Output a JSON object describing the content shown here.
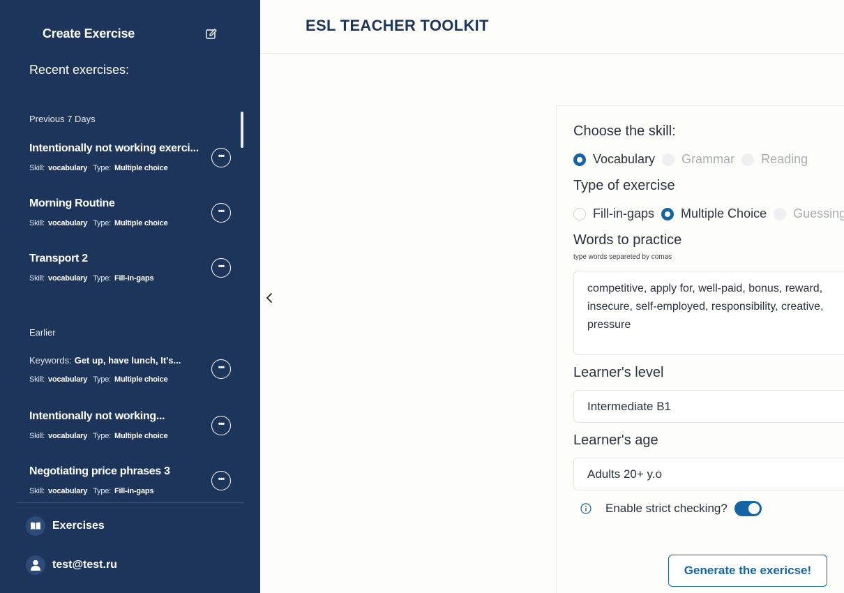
{
  "app": {
    "title": "ESL TEACHER TOOLKIT"
  },
  "sidebar": {
    "create_label": "Create Exercise",
    "recent_label": "Recent exercises:",
    "groups": [
      {
        "label": "Previous 7 Days"
      },
      {
        "label": "Earlier"
      }
    ],
    "meta_labels": {
      "skill": "Skill:",
      "type": "Type:",
      "keywords": "Keywords:"
    },
    "items": [
      {
        "title": "Intentionally not working exerci...",
        "skill": "vocabulary",
        "type": "Multiple choice"
      },
      {
        "title": "Morning Routine",
        "skill": "vocabulary",
        "type": "Multiple choice"
      },
      {
        "title": "Transport 2",
        "skill": "vocabulary",
        "type": "Fill-in-gaps"
      },
      {
        "keywords": "Get up, have lunch, It's...",
        "skill": "vocabulary",
        "type": "Multiple choice"
      },
      {
        "title": "Intentionally not working...",
        "skill": "vocabulary",
        "type": "Multiple choice"
      },
      {
        "title": "Negotiating price phrases 3",
        "skill": "vocabulary",
        "type": "Fill-in-gaps"
      }
    ],
    "nav": {
      "exercises_label": "Exercises",
      "user_email": "test@test.ru"
    }
  },
  "form": {
    "skill_label": "Choose the skill:",
    "skills": [
      {
        "label": "Vocabulary",
        "state": "selected"
      },
      {
        "label": "Grammar",
        "state": "disabled"
      },
      {
        "label": "Reading",
        "state": "disabled"
      }
    ],
    "type_label": "Type of exercise",
    "types": [
      {
        "label": "Fill-in-gaps",
        "state": "unselected"
      },
      {
        "label": "Multiple Choice",
        "state": "selected"
      },
      {
        "label": "Guessing",
        "state": "disabled"
      }
    ],
    "words_label": "Words to practice",
    "words_hint": "type words separeted by comas",
    "words_value": "competitive, apply for, well-paid, bonus, reward, insecure, self-employed, responsibility, creative, pressure",
    "level_label": "Learner's level",
    "level_value": "Intermediate B1",
    "age_label": "Learner's age",
    "age_value": "Adults 20+ y.o",
    "strict_label": "Enable strict checking?",
    "strict_enabled": true,
    "generate_label": "Generate the exericse!"
  },
  "colors": {
    "sidebar_bg": "#1d355a",
    "accent": "#1565a6",
    "page_bg": "#fdfdfa"
  }
}
